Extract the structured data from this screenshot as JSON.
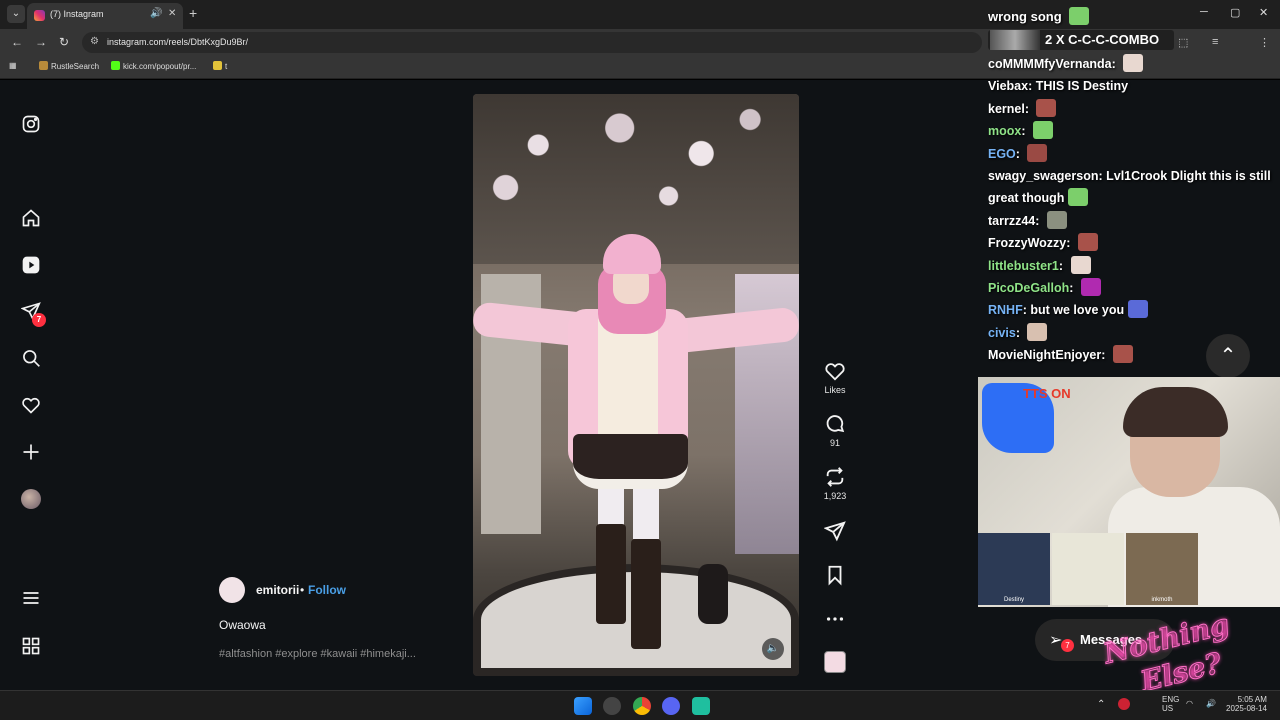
{
  "browser": {
    "tab_title": "(7) Instagram",
    "audio_icon": "speaker-icon",
    "url": "instagram.com/reels/DbtKxgDu9Br/",
    "bookmarks": [
      {
        "label": "RustleSearch",
        "color": "#b78a3a"
      },
      {
        "label": "kick.com/popout/pr...",
        "color": "#53fc18"
      },
      {
        "label": "t",
        "color": "#e3c33a"
      }
    ]
  },
  "sidebar": {
    "notifications_count": "7",
    "icons": [
      "instagram-logo-icon",
      "home-icon",
      "reels-icon",
      "send-icon",
      "search-icon",
      "heart-icon",
      "plus-icon",
      "profile-avatar",
      "menu-icon",
      "more-icon"
    ]
  },
  "reel": {
    "author": "emitorii",
    "separator": "•",
    "follow_label": "Follow",
    "caption": "Owaowa",
    "hashtags": "#altfashion #explore #kawaii #himekaji...",
    "likes_label": "Likes",
    "comments_count": "91",
    "reposts_count": "1,923"
  },
  "stream": {
    "top_message": "wrong song",
    "combo": "2 X C-C-C-COMBO",
    "chat": [
      {
        "user": "coMMMMfyVernanda",
        "user_color": "#ffffff",
        "text": "",
        "emote_color": "#e8d8d0"
      },
      {
        "user": "Viebax",
        "user_color": "#ffffff",
        "text": "THIS IS Destiny",
        "emote_color": ""
      },
      {
        "user": "kernel",
        "user_color": "#ffffff",
        "text": "",
        "emote_color": "#a8524a"
      },
      {
        "user": "moox",
        "user_color": "#8fe388",
        "text": "",
        "emote_color": "#7ccf6b"
      },
      {
        "user": "EGO",
        "user_color": "#76b3f5",
        "text": "",
        "emote_color": "#9a4a44"
      },
      {
        "user": "swagy_swagerson",
        "user_color": "#ffffff",
        "text": "Lvl1Crook Dlight this is still great though",
        "emote_color": "#7ccf6b"
      },
      {
        "user": "tarrzz44",
        "user_color": "#ffffff",
        "text": "",
        "emote_color": "#8b9080"
      },
      {
        "user": "FrozzyWozzy",
        "user_color": "#ffffff",
        "text": "",
        "emote_color": "#a8524a"
      },
      {
        "user": "littlebuster1",
        "user_color": "#8fe388",
        "text": "",
        "emote_color": "#e8d8d0"
      },
      {
        "user": "PicoDeGalloh",
        "user_color": "#8fe388",
        "text": "",
        "emote_color": "#b02ab0"
      },
      {
        "user": "RNHF",
        "user_color": "#76b3f5",
        "text": "but we love you",
        "emote_color": "#5a6ad8"
      },
      {
        "user": "civis",
        "user_color": "#76b3f5",
        "text": "",
        "emote_color": "#d8c0b0"
      },
      {
        "user": "MovieNightEnjoyer",
        "user_color": "#ffffff",
        "text": "",
        "emote_color": "#a8524a"
      }
    ],
    "tts_label": "TTS ON",
    "cam_tiles": [
      "Destiny",
      "",
      "inkmoth"
    ],
    "messages_label": "Messages",
    "messages_badge": "7",
    "logo_text": "Nothing Else?"
  },
  "taskbar": {
    "lang_top": "ENG",
    "lang_bottom": "US",
    "time": "5:05 AM",
    "date": "2025-08-14"
  }
}
